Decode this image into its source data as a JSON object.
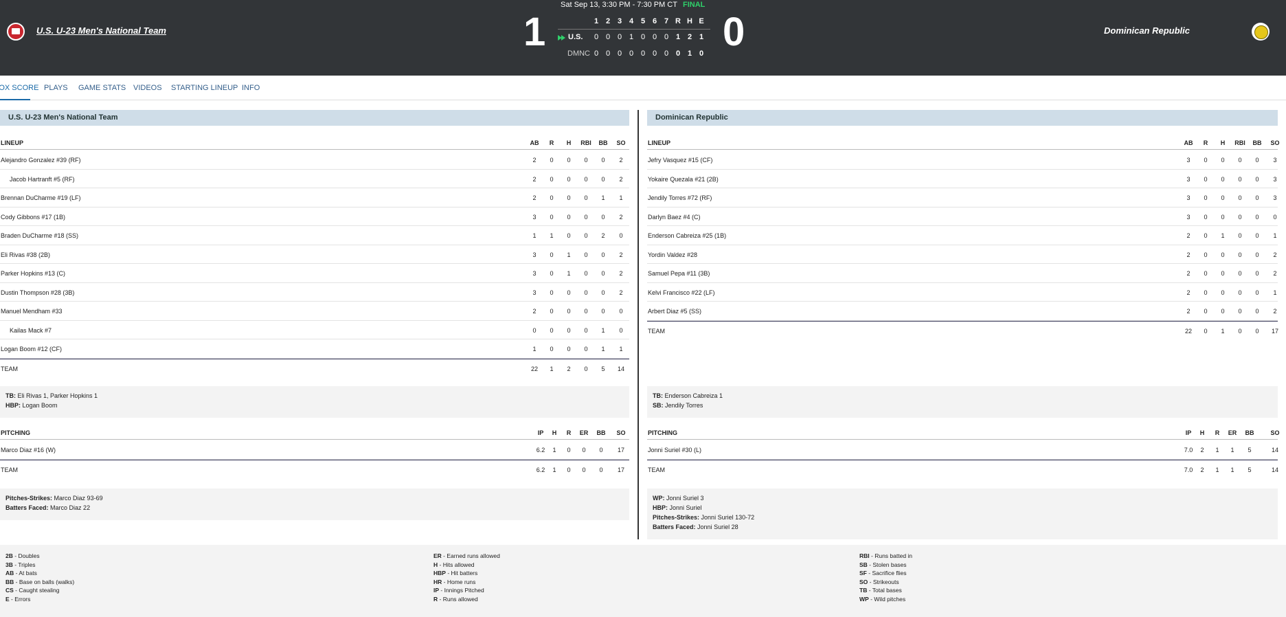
{
  "header": {
    "datetime": "Sat Sep 13, 3:30 PM - 7:30 PM CT",
    "status": "FINAL",
    "home_team_name": "U.S. U-23 Men's National Team",
    "away_team_name": "Dominican Republic",
    "home_score": "1",
    "away_score": "0",
    "linescore": {
      "columns": [
        "1",
        "2",
        "3",
        "4",
        "5",
        "6",
        "7",
        "R",
        "H",
        "E"
      ],
      "rows": [
        {
          "team": "U.S.",
          "values": [
            "0",
            "0",
            "0",
            "1",
            "0",
            "0",
            "0",
            "1",
            "2",
            "1"
          ]
        },
        {
          "team": "DMNC",
          "values": [
            "0",
            "0",
            "0",
            "0",
            "0",
            "0",
            "0",
            "0",
            "1",
            "0"
          ]
        }
      ]
    }
  },
  "tabs": [
    "BOX SCORE",
    "PLAYS",
    "GAME STATS",
    "VIDEOS",
    "STARTING LINEUP",
    "INFO"
  ],
  "home": {
    "banner": "U.S. U-23 Men's National Team",
    "lineup_header": "LINEUP",
    "batting_cols": [
      "AB",
      "R",
      "H",
      "RBI",
      "BB",
      "SO"
    ],
    "batters": [
      {
        "name": "Alejandro Gonzalez #39 (RF)",
        "sub": false,
        "stats": [
          "2",
          "0",
          "0",
          "0",
          "0",
          "2"
        ]
      },
      {
        "name": "Jacob Hartranft #5 (RF)",
        "sub": true,
        "stats": [
          "2",
          "0",
          "0",
          "0",
          "0",
          "2"
        ]
      },
      {
        "name": "Brennan DuCharme #19 (LF)",
        "sub": false,
        "stats": [
          "2",
          "0",
          "0",
          "0",
          "1",
          "1"
        ]
      },
      {
        "name": "Cody Gibbons #17 (1B)",
        "sub": false,
        "stats": [
          "3",
          "0",
          "0",
          "0",
          "0",
          "2"
        ]
      },
      {
        "name": "Braden DuCharme #18 (SS)",
        "sub": false,
        "stats": [
          "1",
          "1",
          "0",
          "0",
          "2",
          "0"
        ]
      },
      {
        "name": "Eli Rivas #38 (2B)",
        "sub": false,
        "stats": [
          "3",
          "0",
          "1",
          "0",
          "0",
          "2"
        ]
      },
      {
        "name": "Parker Hopkins #13 (C)",
        "sub": false,
        "stats": [
          "3",
          "0",
          "1",
          "0",
          "0",
          "2"
        ]
      },
      {
        "name": "Dustin Thompson #28 (3B)",
        "sub": false,
        "stats": [
          "3",
          "0",
          "0",
          "0",
          "0",
          "2"
        ]
      },
      {
        "name": "Manuel Mendham #33",
        "sub": false,
        "stats": [
          "2",
          "0",
          "0",
          "0",
          "0",
          "0"
        ]
      },
      {
        "name": "Kailas Mack #7",
        "sub": true,
        "stats": [
          "0",
          "0",
          "0",
          "0",
          "1",
          "0"
        ]
      },
      {
        "name": "Logan Boom #12 (CF)",
        "sub": false,
        "stats": [
          "1",
          "0",
          "0",
          "0",
          "1",
          "1"
        ]
      }
    ],
    "team_label": "TEAM",
    "team_batting": [
      "22",
      "1",
      "2",
      "0",
      "5",
      "14"
    ],
    "batting_notes": [
      {
        "label": "TB:",
        "text": "Eli Rivas 1, Parker Hopkins 1"
      },
      {
        "label": "HBP:",
        "text": "Logan Boom"
      }
    ],
    "pitching_header": "PITCHING",
    "pitching_cols": [
      "IP",
      "H",
      "R",
      "ER",
      "BB",
      "SO"
    ],
    "pitchers": [
      {
        "name": "Marco Diaz #16 (W)",
        "stats": [
          "6.2",
          "1",
          "0",
          "0",
          "0",
          "17"
        ]
      }
    ],
    "team_pitching": [
      "6.2",
      "1",
      "0",
      "0",
      "0",
      "17"
    ],
    "pitching_notes": [
      {
        "label": "Pitches-Strikes:",
        "text": "Marco Diaz 93-69"
      },
      {
        "label": "Batters Faced:",
        "text": "Marco Diaz 22"
      }
    ]
  },
  "away": {
    "banner": "Dominican Republic",
    "lineup_header": "LINEUP",
    "batting_cols": [
      "AB",
      "R",
      "H",
      "RBI",
      "BB",
      "SO"
    ],
    "batters": [
      {
        "name": "Jefry Vasquez #15 (CF)",
        "sub": false,
        "stats": [
          "3",
          "0",
          "0",
          "0",
          "0",
          "3"
        ]
      },
      {
        "name": "Yokaire Quezala #21 (2B)",
        "sub": false,
        "stats": [
          "3",
          "0",
          "0",
          "0",
          "0",
          "3"
        ]
      },
      {
        "name": "Jendily Torres #72 (RF)",
        "sub": false,
        "stats": [
          "3",
          "0",
          "0",
          "0",
          "0",
          "3"
        ]
      },
      {
        "name": "Darlyn Baez #4 (C)",
        "sub": false,
        "stats": [
          "3",
          "0",
          "0",
          "0",
          "0",
          "0"
        ]
      },
      {
        "name": "Enderson Cabreiza #25 (1B)",
        "sub": false,
        "stats": [
          "2",
          "0",
          "1",
          "0",
          "0",
          "1"
        ]
      },
      {
        "name": "Yordin Valdez #28",
        "sub": false,
        "stats": [
          "2",
          "0",
          "0",
          "0",
          "0",
          "2"
        ]
      },
      {
        "name": "Samuel Pepa #11 (3B)",
        "sub": false,
        "stats": [
          "2",
          "0",
          "0",
          "0",
          "0",
          "2"
        ]
      },
      {
        "name": "Kelvi Francisco #22 (LF)",
        "sub": false,
        "stats": [
          "2",
          "0",
          "0",
          "0",
          "0",
          "1"
        ]
      },
      {
        "name": "Arbert Diaz #5 (SS)",
        "sub": false,
        "stats": [
          "2",
          "0",
          "0",
          "0",
          "0",
          "2"
        ]
      }
    ],
    "team_label": "TEAM",
    "team_batting": [
      "22",
      "0",
      "1",
      "0",
      "0",
      "17"
    ],
    "batting_notes": [
      {
        "label": "TB:",
        "text": "Enderson Cabreiza 1"
      },
      {
        "label": "SB:",
        "text": "Jendily Torres"
      }
    ],
    "pitching_header": "PITCHING",
    "pitching_cols": [
      "IP",
      "H",
      "R",
      "ER",
      "BB",
      "SO"
    ],
    "pitchers": [
      {
        "name": "Jonni Suriel #30 (L)",
        "stats": [
          "7.0",
          "2",
          "1",
          "1",
          "5",
          "14"
        ]
      }
    ],
    "team_pitching": [
      "7.0",
      "2",
      "1",
      "1",
      "5",
      "14"
    ],
    "pitching_notes": [
      {
        "label": "WP:",
        "text": "Jonni Suriel 3"
      },
      {
        "label": "HBP:",
        "text": "Jonni Suriel"
      },
      {
        "label": "Pitches-Strikes:",
        "text": "Jonni Suriel 130-72"
      },
      {
        "label": "Batters Faced:",
        "text": "Jonni Suriel 28"
      }
    ]
  },
  "glossary": [
    [
      {
        "abbr": "2B",
        "text": "Doubles"
      },
      {
        "abbr": "3B",
        "text": "Triples"
      },
      {
        "abbr": "AB",
        "text": "At bats"
      },
      {
        "abbr": "BB",
        "text": "Base on balls (walks)"
      },
      {
        "abbr": "CS",
        "text": "Caught stealing"
      },
      {
        "abbr": "E",
        "text": "Errors"
      }
    ],
    [
      {
        "abbr": "ER",
        "text": "Earned runs allowed"
      },
      {
        "abbr": "H",
        "text": "Hits allowed"
      },
      {
        "abbr": "HBP",
        "text": "Hit batters"
      },
      {
        "abbr": "HR",
        "text": "Home runs"
      },
      {
        "abbr": "IP",
        "text": "Innings Pitched"
      },
      {
        "abbr": "R",
        "text": "Runs allowed"
      }
    ],
    [
      {
        "abbr": "RBI",
        "text": "Runs batted in"
      },
      {
        "abbr": "SB",
        "text": "Stolen bases"
      },
      {
        "abbr": "SF",
        "text": "Sacrifice flies"
      },
      {
        "abbr": "SO",
        "text": "Strikeouts"
      },
      {
        "abbr": "TB",
        "text": "Total bases"
      },
      {
        "abbr": "WP",
        "text": "Wild pitches"
      }
    ]
  ],
  "colors": {
    "header_bg": "#323538",
    "final_green": "#2fd06a",
    "banner_bg": "#cfdde8",
    "tab_link": "#335e8a",
    "notes_bg": "#f3f3f3"
  }
}
